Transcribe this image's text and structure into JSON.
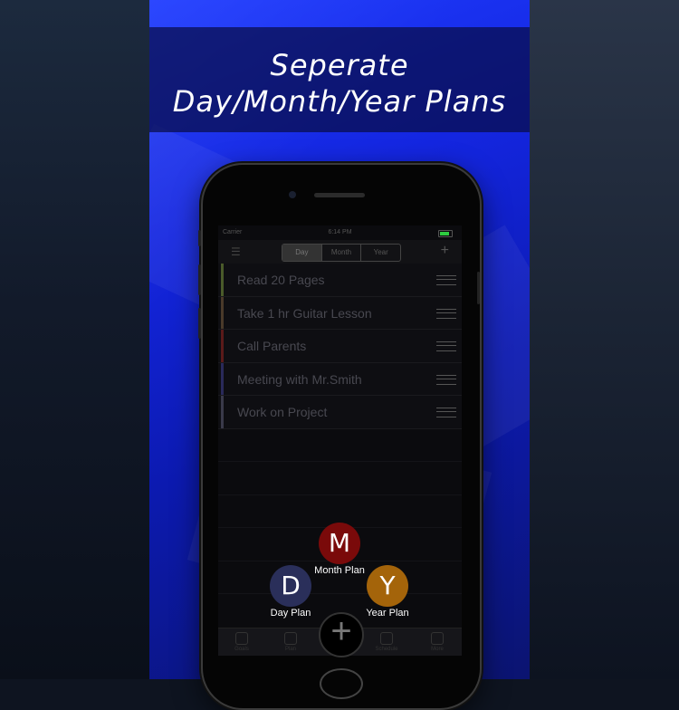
{
  "headline": {
    "line1": "Seperate",
    "line2": "Day/Month/Year Plans"
  },
  "status_bar": {
    "carrier": "Carrier",
    "time": "6:14 PM",
    "battery_level": 0.8
  },
  "segments": [
    "Day",
    "Month",
    "Year"
  ],
  "tasks": [
    {
      "title": "Read 20 Pages",
      "color": "#4a5a2a"
    },
    {
      "title": "Take 1 hr Guitar Lesson",
      "color": "#4a3a2a"
    },
    {
      "title": "Call Parents",
      "color": "#5a1a1a"
    },
    {
      "title": "Meeting with Mr.Smith",
      "color": "#2a2a5a"
    },
    {
      "title": "Work on Project",
      "color": "#3a3a4a"
    }
  ],
  "fab_menu": {
    "month": {
      "letter": "M",
      "label": "Month Plan",
      "color": "#7a0a0a"
    },
    "day": {
      "letter": "D",
      "label": "Day Plan",
      "color": "#2a2f5a"
    },
    "year": {
      "letter": "Y",
      "label": "Year Plan",
      "color": "#a4640a"
    }
  },
  "tabs": [
    "Goals",
    "Plan",
    "Schedule",
    "More"
  ],
  "icons": {
    "list": "list-icon",
    "add": "plus-icon",
    "drag": "drag-handle-icon",
    "fab": "plus-icon"
  }
}
